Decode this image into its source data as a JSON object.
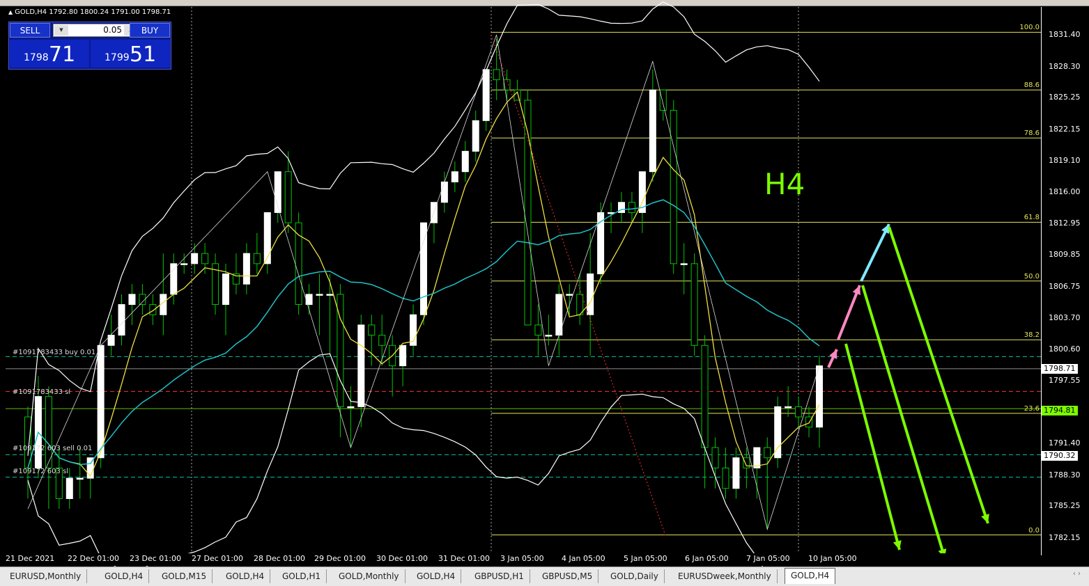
{
  "window": {
    "symbol_info": "GOLD,H4  1792.80 1800.24 1791.00 1798.71"
  },
  "trade_panel": {
    "sell_label": "SELL",
    "buy_label": "BUY",
    "lot_value": "0.05",
    "sell_price_small": "1798",
    "sell_price_big": "71",
    "buy_price_small": "1799",
    "buy_price_big": "51"
  },
  "annotations": {
    "timeframe_label": "H4",
    "order_buy": "#1091783433 buy 0.01",
    "order_sl": "#1091783433 sl",
    "order_sell": "#109172  603 sell 0.01",
    "order_sell_sl": "#109172  603 sl"
  },
  "colors": {
    "bull_candle": "#ffffff",
    "bear_candle": "#00c800",
    "fib_line": "#e6e65a",
    "ma_yellow": "#f0e040",
    "ma_cyan": "#20c0c8",
    "bollinger": "#ffffff",
    "arrow_green": "#7cfc00",
    "arrow_pink": "#ff88c0",
    "arrow_cyan": "#80e8ff",
    "sl_line": "#ff3030"
  },
  "chart_data": {
    "type": "candlestick",
    "symbol": "GOLD",
    "timeframe": "H4",
    "y_ticks": [
      "1831.40",
      "1828.30",
      "1825.25",
      "1822.15",
      "1819.10",
      "1816.00",
      "1812.95",
      "1809.85",
      "1806.75",
      "1803.70",
      "1800.60",
      "1797.55",
      "1791.40",
      "1788.30",
      "1785.25",
      "1782.15"
    ],
    "x_ticks": [
      "21 Dec 2021",
      "22 Dec 01:00",
      "23 Dec 01:00",
      "27 Dec 01:00",
      "28 Dec 01:00",
      "29 Dec 01:00",
      "30 Dec 01:00",
      "31 Dec 01:00",
      "3 Jan 05:00",
      "4 Jan 05:00",
      "5 Jan 05:00",
      "6 Jan 05:00",
      "7 Jan 05:00",
      "10 Jan 05:00"
    ],
    "current_bid": "1798.71",
    "tag_green": "1794.81",
    "tag_white": "1790.32",
    "fib_levels": [
      {
        "label": "100.0",
        "price": 1831.65
      },
      {
        "label": "88.6",
        "price": 1826.0
      },
      {
        "label": "78.6",
        "price": 1821.3
      },
      {
        "label": "61.8",
        "price": 1813.05
      },
      {
        "label": "50.0",
        "price": 1807.3
      },
      {
        "label": "38.2",
        "price": 1801.55
      },
      {
        "label": "23.6",
        "price": 1794.35
      },
      {
        "label": "0.0",
        "price": 1782.45
      }
    ],
    "ohlc": [
      [
        1794,
        1795,
        1786,
        1789
      ],
      [
        1789,
        1798,
        1788,
        1796
      ],
      [
        1796,
        1797,
        1785,
        1789
      ],
      [
        1789,
        1791,
        1785,
        1786
      ],
      [
        1786,
        1789,
        1785,
        1788
      ],
      [
        1788,
        1791,
        1786,
        1788
      ],
      [
        1788,
        1790,
        1786,
        1790
      ],
      [
        1790,
        1801,
        1789,
        1801
      ],
      [
        1801,
        1804,
        1800,
        1802
      ],
      [
        1802,
        1806,
        1801,
        1805
      ],
      [
        1805,
        1807,
        1803,
        1806
      ],
      [
        1806,
        1807,
        1804,
        1805
      ],
      [
        1805,
        1806,
        1803,
        1804
      ],
      [
        1804,
        1810,
        1802,
        1806
      ],
      [
        1806,
        1810,
        1805,
        1809
      ],
      [
        1809,
        1810,
        1808,
        1809
      ],
      [
        1809,
        1811,
        1808,
        1810
      ],
      [
        1810,
        1811,
        1808,
        1809
      ],
      [
        1809,
        1810,
        1804,
        1805
      ],
      [
        1805,
        1809,
        1802,
        1808
      ],
      [
        1808,
        1810,
        1806,
        1807
      ],
      [
        1807,
        1811,
        1806,
        1810
      ],
      [
        1810,
        1812,
        1808,
        1809
      ],
      [
        1809,
        1813,
        1808,
        1814
      ],
      [
        1814,
        1818,
        1813,
        1818
      ],
      [
        1818,
        1820,
        1812,
        1813
      ],
      [
        1813,
        1814,
        1804,
        1805
      ],
      [
        1805,
        1807,
        1804,
        1806
      ],
      [
        1806,
        1808,
        1802,
        1806
      ],
      [
        1806,
        1808,
        1800,
        1806
      ],
      [
        1806,
        1807,
        1792,
        1795
      ],
      [
        1795,
        1797,
        1791,
        1795
      ],
      [
        1795,
        1804,
        1793,
        1803
      ],
      [
        1803,
        1804,
        1799,
        1802
      ],
      [
        1802,
        1804,
        1799,
        1801
      ],
      [
        1801,
        1802,
        1796,
        1799
      ],
      [
        1799,
        1801,
        1797,
        1801
      ],
      [
        1801,
        1805,
        1800,
        1804
      ],
      [
        1804,
        1813,
        1803,
        1813
      ],
      [
        1813,
        1815,
        1811,
        1815
      ],
      [
        1815,
        1818,
        1814,
        1817
      ],
      [
        1817,
        1819,
        1816,
        1818
      ],
      [
        1818,
        1821,
        1817,
        1820
      ],
      [
        1820,
        1824,
        1819,
        1823
      ],
      [
        1823,
        1828,
        1822,
        1828
      ],
      [
        1828,
        1831,
        1825,
        1827
      ],
      [
        1827,
        1828,
        1825,
        1826
      ],
      [
        1826,
        1827,
        1825,
        1825
      ],
      [
        1825,
        1826,
        1803,
        1803
      ],
      [
        1803,
        1805,
        1800,
        1802
      ],
      [
        1802,
        1804,
        1801,
        1802
      ],
      [
        1802,
        1807,
        1800,
        1806
      ],
      [
        1806,
        1807,
        1804,
        1806
      ],
      [
        1806,
        1808,
        1803,
        1804
      ],
      [
        1804,
        1812,
        1800,
        1808
      ],
      [
        1808,
        1815,
        1807,
        1814
      ],
      [
        1814,
        1815,
        1812,
        1814
      ],
      [
        1814,
        1816,
        1813,
        1815
      ],
      [
        1815,
        1816,
        1813,
        1814
      ],
      [
        1814,
        1818,
        1812,
        1818
      ],
      [
        1818,
        1828,
        1817,
        1826
      ],
      [
        1826,
        1826,
        1823,
        1824
      ],
      [
        1824,
        1825,
        1808,
        1809
      ],
      [
        1809,
        1811,
        1806,
        1809
      ],
      [
        1809,
        1810,
        1800,
        1801
      ],
      [
        1801,
        1802,
        1787,
        1791
      ],
      [
        1791,
        1792,
        1787,
        1789
      ],
      [
        1789,
        1791,
        1786,
        1787
      ],
      [
        1787,
        1791,
        1786,
        1790
      ],
      [
        1790,
        1791,
        1787,
        1789
      ],
      [
        1789,
        1790,
        1786,
        1791
      ],
      [
        1791,
        1792,
        1783,
        1790
      ],
      [
        1790,
        1796,
        1789,
        1795
      ],
      [
        1795,
        1797,
        1794,
        1795
      ],
      [
        1795,
        1796,
        1793,
        1794
      ],
      [
        1794,
        1795,
        1792,
        1793
      ],
      [
        1793,
        1800,
        1791,
        1799
      ]
    ],
    "order_lines": [
      {
        "price": 1799.9,
        "color": "#00c8a0"
      },
      {
        "price": 1796.5,
        "color": "#ff3030"
      },
      {
        "price": 1790.3,
        "color": "#00c8a0"
      },
      {
        "price": 1788.1,
        "color": "#00c8a0"
      }
    ]
  },
  "tabs": {
    "items": [
      "EURUSD,Monthly",
      "GOLD,H4",
      "GOLD,M15",
      "GOLD,H4",
      "GOLD,H1",
      "GOLD,Monthly",
      "GOLD,H4",
      "GBPUSD,H1",
      "GBPUSD,M5",
      "GOLD,Daily",
      "EURUSDweek,Monthly",
      "GOLD,H4"
    ],
    "active_index": 11
  }
}
